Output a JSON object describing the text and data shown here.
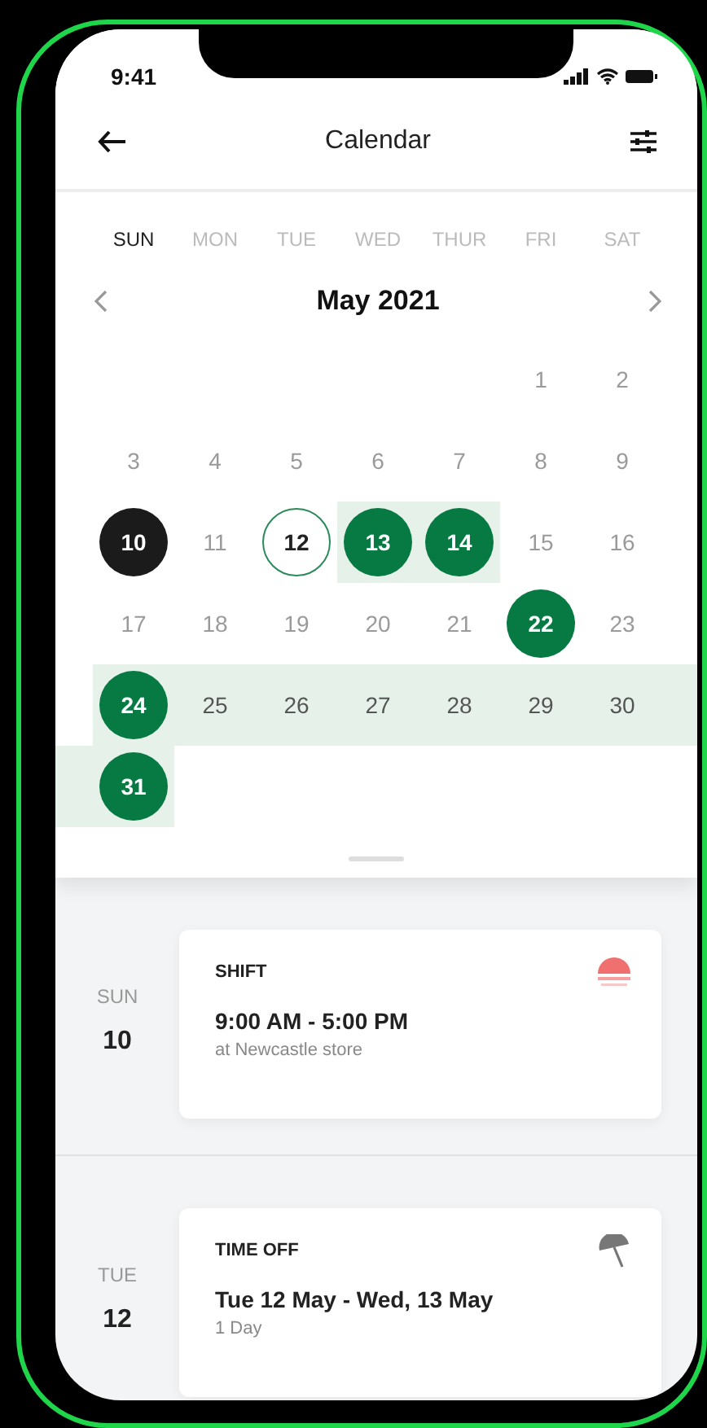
{
  "status_bar": {
    "time": "9:41"
  },
  "header": {
    "title": "Calendar"
  },
  "calendar": {
    "weekdays": [
      {
        "label": "SUN",
        "selected": true
      },
      {
        "label": "MON",
        "selected": false
      },
      {
        "label": "TUE",
        "selected": false
      },
      {
        "label": "WED",
        "selected": false
      },
      {
        "label": "THUR",
        "selected": false
      },
      {
        "label": "FRI",
        "selected": false
      },
      {
        "label": "SAT",
        "selected": false
      }
    ],
    "month": "May 2021",
    "weeks": [
      [
        {
          "label": "1",
          "kind": "day",
          "highlighted": false
        },
        {
          "label": "2",
          "kind": "day",
          "highlighted": false
        }
      ],
      [
        {
          "label": "3",
          "kind": "day",
          "highlighted": false
        },
        {
          "label": "4",
          "kind": "day",
          "highlighted": false
        },
        {
          "label": "5",
          "kind": "day",
          "highlighted": false
        },
        {
          "label": "6",
          "kind": "day",
          "highlighted": false
        },
        {
          "label": "7",
          "kind": "day",
          "highlighted": false
        },
        {
          "label": "8",
          "kind": "day",
          "highlighted": false
        },
        {
          "label": "9",
          "kind": "day",
          "highlighted": false
        }
      ],
      [
        {
          "label": "10",
          "kind": "today",
          "highlighted": false
        },
        {
          "label": "11",
          "kind": "day",
          "highlighted": false
        },
        {
          "label": "12",
          "kind": "selected",
          "highlighted": false
        },
        {
          "label": "13",
          "kind": "event",
          "highlighted": true
        },
        {
          "label": "14",
          "kind": "event",
          "highlighted": true
        },
        {
          "label": "15",
          "kind": "day",
          "highlighted": false
        },
        {
          "label": "16",
          "kind": "day",
          "highlighted": false
        }
      ],
      [
        {
          "label": "17",
          "kind": "day",
          "highlighted": false
        },
        {
          "label": "18",
          "kind": "day",
          "highlighted": false
        },
        {
          "label": "19",
          "kind": "day",
          "highlighted": false
        },
        {
          "label": "20",
          "kind": "day",
          "highlighted": false
        },
        {
          "label": "21",
          "kind": "day",
          "highlighted": false
        },
        {
          "label": "22",
          "kind": "event",
          "highlighted": false
        },
        {
          "label": "23",
          "kind": "day",
          "highlighted": false
        }
      ],
      [
        {
          "label": "24",
          "kind": "event",
          "highlighted": true
        },
        {
          "label": "25",
          "kind": "day",
          "highlighted": true
        },
        {
          "label": "26",
          "kind": "day",
          "highlighted": true
        },
        {
          "label": "27",
          "kind": "day",
          "highlighted": true
        },
        {
          "label": "28",
          "kind": "day",
          "highlighted": true
        },
        {
          "label": "29",
          "kind": "day",
          "highlighted": true
        },
        {
          "label": "30",
          "kind": "day",
          "highlighted": true
        }
      ],
      [
        {
          "label": "31",
          "kind": "event",
          "highlighted": true
        }
      ]
    ]
  },
  "agenda": [
    {
      "weekday": "SUN",
      "day": "10",
      "kind": "shift",
      "type": "SHIFT",
      "title": "9:00 AM - 5:00 PM",
      "detail": "at Newcastle store"
    },
    {
      "weekday": "TUE",
      "day": "12",
      "kind": "time_off",
      "type": "TIME OFF",
      "title": "Tue 12 May - Wed, 13 May",
      "detail": "1 Day"
    }
  ]
}
